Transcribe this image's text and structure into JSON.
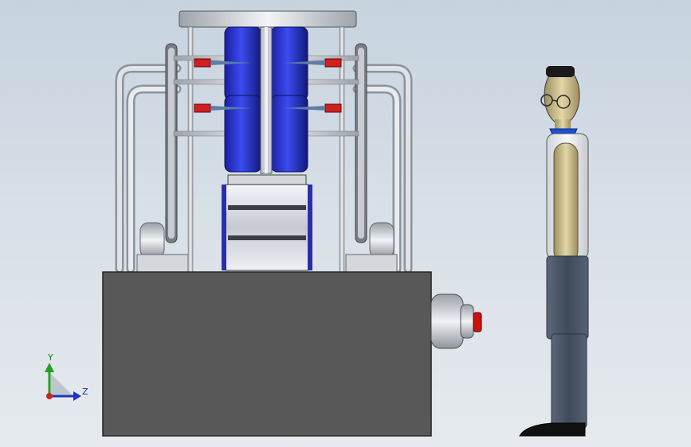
{
  "viewport": {
    "view_name": "cad-front-view",
    "background_top": "#c6d3df",
    "background_bottom": "#e6eaee"
  },
  "triad": {
    "y_label": "Y",
    "z_label": "Z",
    "y_color": "#22a022",
    "z_color": "#2233bb",
    "origin_color": "#cc2222"
  },
  "colors": {
    "base_box": "#585858",
    "magnet_blue": "#1f2fd0",
    "rod": "#c9ccd2",
    "red_tip": "#d02020",
    "button_red": "#cc1111",
    "shirt": "#e8ecf0",
    "trousers": "#4a5666",
    "skin": "#c9b98a",
    "collar": "#1a4fd8"
  },
  "icons": [
    "axis-triad-icon"
  ]
}
